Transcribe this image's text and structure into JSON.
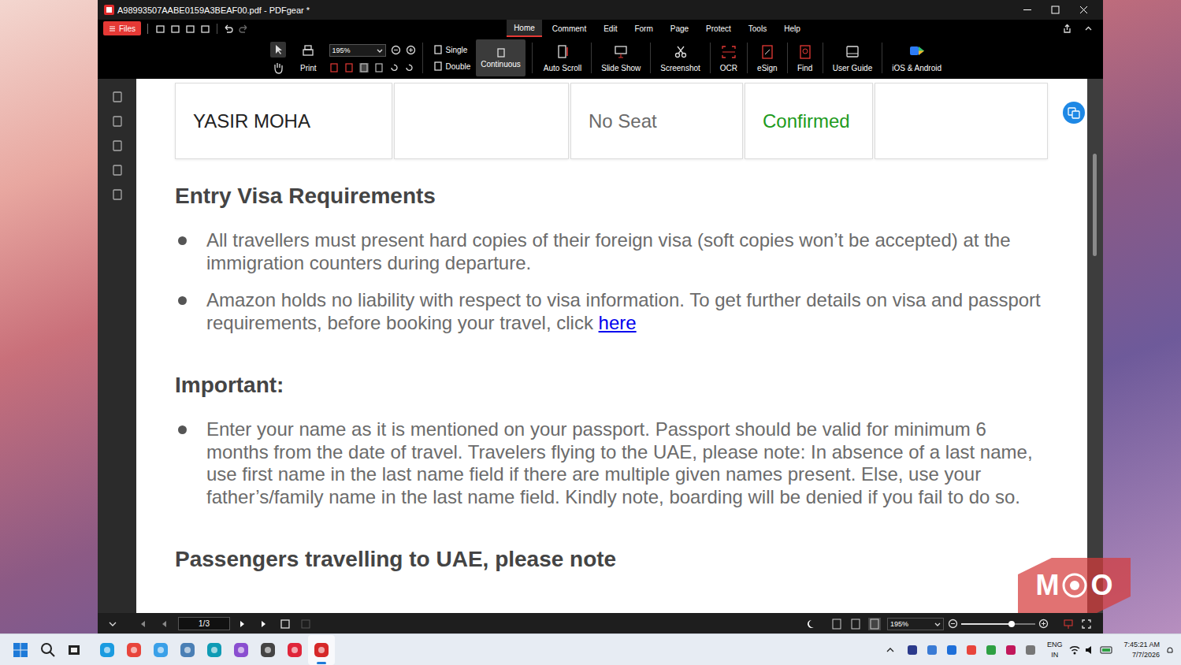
{
  "window": {
    "title": "A98993507AABE0159A3BEAF00.pdf - PDFgear *"
  },
  "files_button": {
    "label": "Files"
  },
  "menu_tabs": [
    {
      "label": "Home",
      "selected": true
    },
    {
      "label": "Comment",
      "selected": false
    },
    {
      "label": "Edit",
      "selected": false
    },
    {
      "label": "Form",
      "selected": false
    },
    {
      "label": "Page",
      "selected": false
    },
    {
      "label": "Protect",
      "selected": false
    },
    {
      "label": "Tools",
      "selected": false
    },
    {
      "label": "Help",
      "selected": false
    }
  ],
  "toolbar": {
    "print": "Print",
    "zoom": "195%",
    "view_modes": [
      {
        "label": "Single",
        "selected": false
      },
      {
        "label": "Double",
        "selected": false
      },
      {
        "label": "Continuous",
        "selected": true
      }
    ],
    "tools": [
      {
        "label": "Auto Scroll"
      },
      {
        "label": "Slide Show"
      },
      {
        "label": "Screenshot"
      },
      {
        "label": "OCR"
      },
      {
        "label": "eSign"
      },
      {
        "label": "Find"
      },
      {
        "label": "User Guide"
      },
      {
        "label": "iOS & Android"
      }
    ]
  },
  "document": {
    "passenger_row": [
      {
        "text": "YASIR MOHA",
        "color": "#222222"
      },
      {
        "text": "",
        "color": "#222222"
      },
      {
        "text": "No Seat",
        "color": "#6b6b6b"
      },
      {
        "text": "Confirmed",
        "color": "#1e9b1e"
      },
      {
        "text": "",
        "color": "#222222"
      }
    ],
    "sections": [
      {
        "heading": "Entry Visa Requirements",
        "bullets": [
          {
            "text": "All travellers must present hard copies of their foreign visa (soft copies won’t be accepted) at the immigration counters during departure.",
            "link": ""
          },
          {
            "text": "Amazon holds no liability with respect to visa information. To get further details on visa and passport requirements, before booking your travel, click ",
            "link": "here"
          }
        ]
      },
      {
        "heading": "Important:",
        "bullets": [
          {
            "text": "Enter your name as it is mentioned on your passport. Passport should be valid for minimum 6 months from the date of travel. Travelers flying to the UAE, please note: In absence of a last name, use first name in the last name field if there are multiple given names present. Else, use your father’s/family name in the last name field. Kindly note, boarding will be denied if you fail to do so.",
            "link": ""
          }
        ]
      },
      {
        "heading": "Passengers travelling to UAE, please note",
        "bullets": []
      }
    ]
  },
  "status_bar": {
    "page": "1/3",
    "zoom": "195%",
    "zoom_slider_level": 0.68
  },
  "taskbar": {
    "apps": [
      {
        "selected": false
      },
      {
        "selected": false
      },
      {
        "selected": false
      },
      {
        "selected": false
      },
      {
        "selected": false
      },
      {
        "selected": false
      },
      {
        "selected": false
      },
      {
        "selected": false
      },
      {
        "selected": true
      }
    ],
    "language": "ENG",
    "region": "IN",
    "time": "7:45:21 AM",
    "date": "7/7/2026"
  },
  "watermark": {
    "left": "M",
    "right": "O"
  }
}
